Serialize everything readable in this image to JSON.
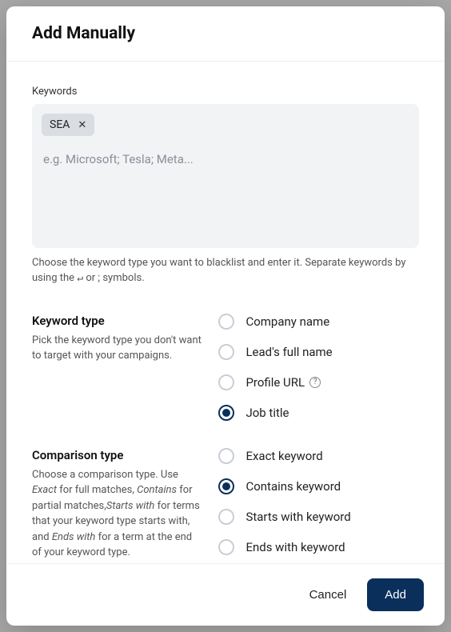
{
  "modal": {
    "title": "Add Manually"
  },
  "keywords": {
    "label": "Keywords",
    "chips": [
      "SEA"
    ],
    "placeholder": "e.g. Microsoft; Tesla; Meta...",
    "help_prefix": "Choose the keyword type you want to blacklist and enter it. Separate keywords by using the ",
    "help_symbols": "↵",
    "help_suffix": " or ; symbols."
  },
  "keyword_type": {
    "heading": "Keyword type",
    "description": "Pick the keyword type you don't want to target with your campaigns.",
    "options": [
      {
        "label": "Company name",
        "selected": false,
        "help": false
      },
      {
        "label": "Lead's full name",
        "selected": false,
        "help": false
      },
      {
        "label": "Profile URL",
        "selected": false,
        "help": true
      },
      {
        "label": "Job title",
        "selected": true,
        "help": false
      }
    ]
  },
  "comparison_type": {
    "heading": "Comparison type",
    "desc_plain": "Choose a comparison type. Use Exact for full matches, Contains for partial matches, Starts with for terms that your keyword type starts with, and Ends with for a term at the end of your keyword type.",
    "options": [
      {
        "label": "Exact keyword",
        "selected": false
      },
      {
        "label": "Contains keyword",
        "selected": true
      },
      {
        "label": "Starts with keyword",
        "selected": false
      },
      {
        "label": "Ends with keyword",
        "selected": false
      }
    ]
  },
  "footer": {
    "cancel": "Cancel",
    "add": "Add"
  }
}
